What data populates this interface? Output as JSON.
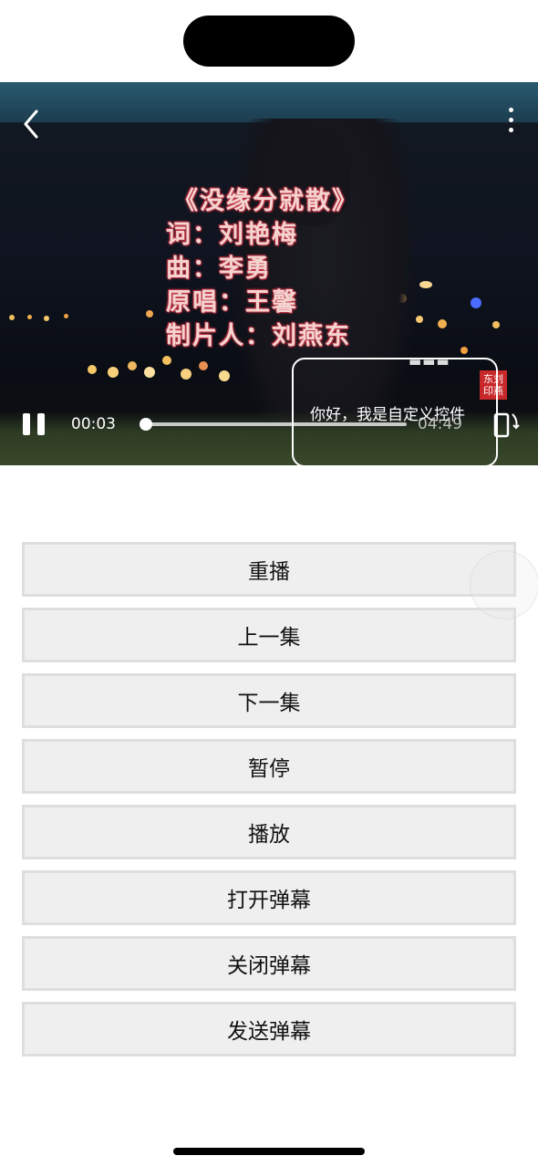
{
  "player": {
    "lyrics": {
      "title": "《没缘分就散》",
      "lyricist": "词：刘艳梅",
      "composer": "曲：李勇",
      "original_singer": "原唱：王馨",
      "producer": "制片人：刘燕东"
    },
    "current_time": "00:03",
    "total_time": "04:49",
    "progress_fraction": 0.01,
    "custom_control_text": "你好，我是自定义控件",
    "seal_text": "东刘印燕"
  },
  "buttons": [
    {
      "label": "重播"
    },
    {
      "label": "上一集"
    },
    {
      "label": "下一集"
    },
    {
      "label": "暂停"
    },
    {
      "label": "播放"
    },
    {
      "label": "打开弹幕"
    },
    {
      "label": "关闭弹幕"
    },
    {
      "label": "发送弹幕"
    }
  ],
  "icons": {
    "back": "chevron-left-icon",
    "more": "more-vertical-icon",
    "pause": "pause-icon",
    "rotate": "rotate-screen-icon"
  }
}
